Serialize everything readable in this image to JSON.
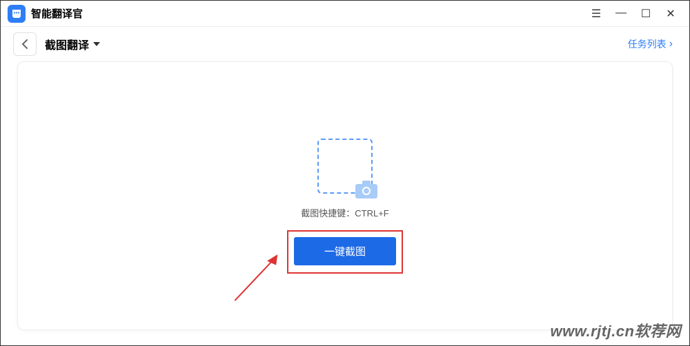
{
  "titlebar": {
    "app_name": "智能翻译官"
  },
  "toolbar": {
    "back_icon": "chevron-left-icon",
    "mode_label": "截图翻译",
    "task_list_label": "任务列表"
  },
  "main": {
    "shortcut_hint": "截图快捷键：CTRL+F",
    "action_button": "一键截图"
  },
  "watermark": "www.rjtj.cn软荐网"
}
